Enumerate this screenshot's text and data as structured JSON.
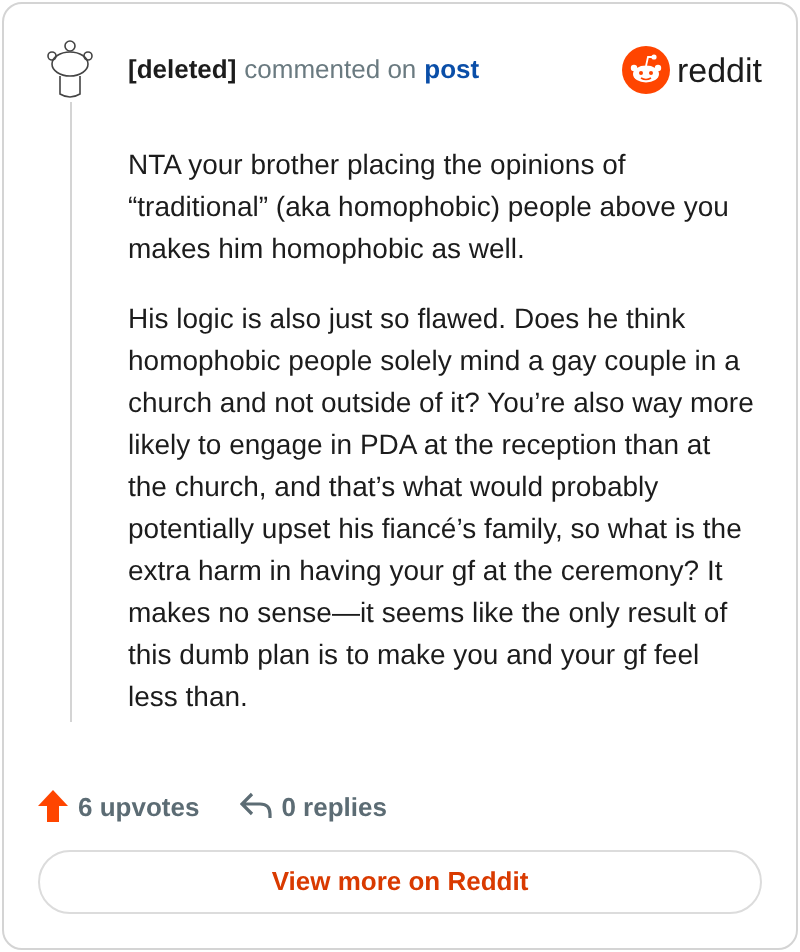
{
  "header": {
    "author": "[deleted]",
    "action": "commented on",
    "link": "post",
    "logo_text": "reddit"
  },
  "body": [
    "NTA your brother placing the opinions of “traditional” (aka homophobic) people above you makes him homophobic as well.",
    "His logic is also just so flawed. Does he think homophobic people solely mind a gay couple in a church and not outside of it? You’re also way more likely to engage in PDA at the reception than at the church, and that’s what would probably potentially upset his fiancé’s family, so what is the extra harm in having your gf at the ceremony? It makes no sense—it seems like the only result of this dumb plan is to make you and your gf feel less than."
  ],
  "footer": {
    "upvotes": "6 upvotes",
    "replies": "0 replies"
  },
  "button": "View more on Reddit"
}
